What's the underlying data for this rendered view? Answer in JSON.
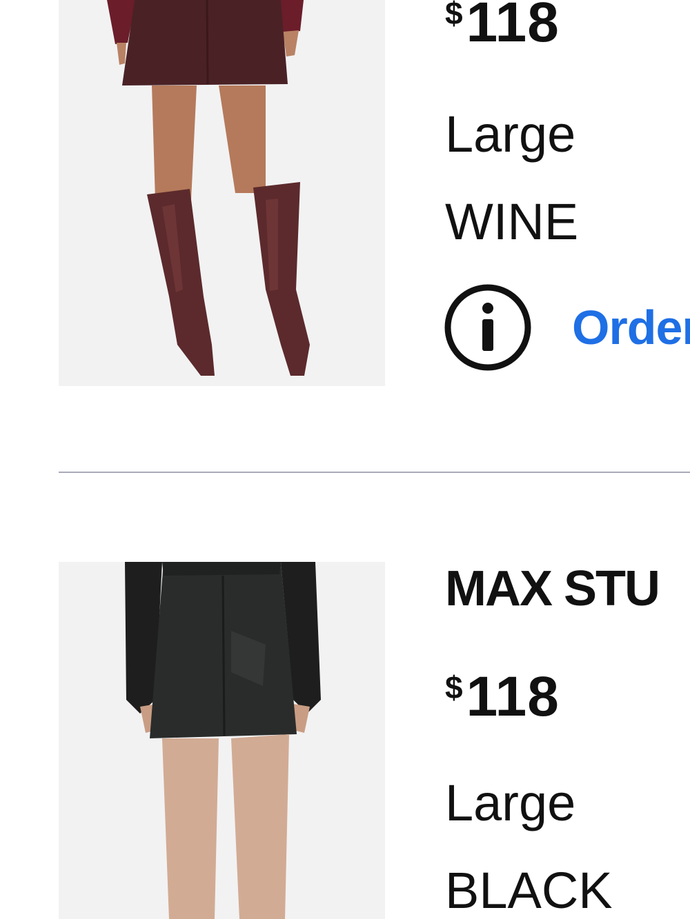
{
  "items": [
    {
      "currency": "$",
      "price": "118",
      "size": "Large",
      "color": "WINE",
      "order_link": "Order"
    },
    {
      "name": "MAX STU",
      "currency": "$",
      "price": "118",
      "size": "Large",
      "color": "BLACK"
    }
  ],
  "icons": {
    "info": "info-circle-icon"
  },
  "colors": {
    "link": "#1f6fe5",
    "divider": "#a9aab8",
    "text": "#111111",
    "image_bg": "#f2f2f3"
  }
}
